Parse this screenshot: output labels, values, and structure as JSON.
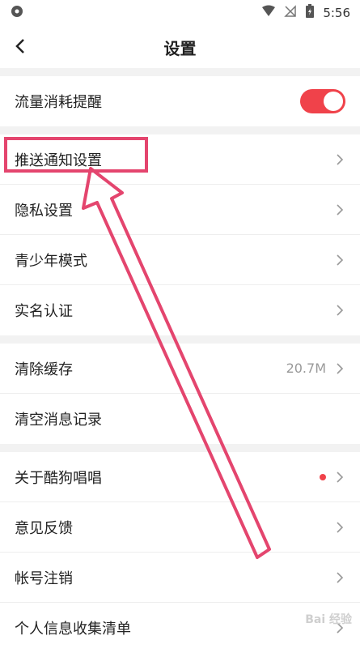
{
  "status_bar": {
    "time": "5:56",
    "icons": [
      "app-status-icon",
      "signal-icon",
      "no-sim-icon",
      "battery-charging-icon"
    ]
  },
  "header": {
    "title": "设置",
    "back_icon": "chevron-left-icon"
  },
  "sections": [
    {
      "items": [
        {
          "label": "流量消耗提醒",
          "toggle": true
        }
      ]
    },
    {
      "items": [
        {
          "label": "推送通知设置"
        },
        {
          "label": "隐私设置"
        },
        {
          "label": "青少年模式"
        },
        {
          "label": "实名认证"
        }
      ]
    },
    {
      "items": [
        {
          "label": "清除缓存",
          "value": "20.7M"
        },
        {
          "label": "清空消息记录"
        }
      ]
    },
    {
      "items": [
        {
          "label": "关于酷狗唱唱",
          "badge": "red-dot"
        },
        {
          "label": "意见反馈"
        },
        {
          "label": "帐号注销"
        },
        {
          "label": "个人信息收集清单"
        }
      ]
    }
  ],
  "watermark": "Bai 经验",
  "colors": {
    "accent": "#f0424a",
    "annotation": "#e4456e"
  }
}
